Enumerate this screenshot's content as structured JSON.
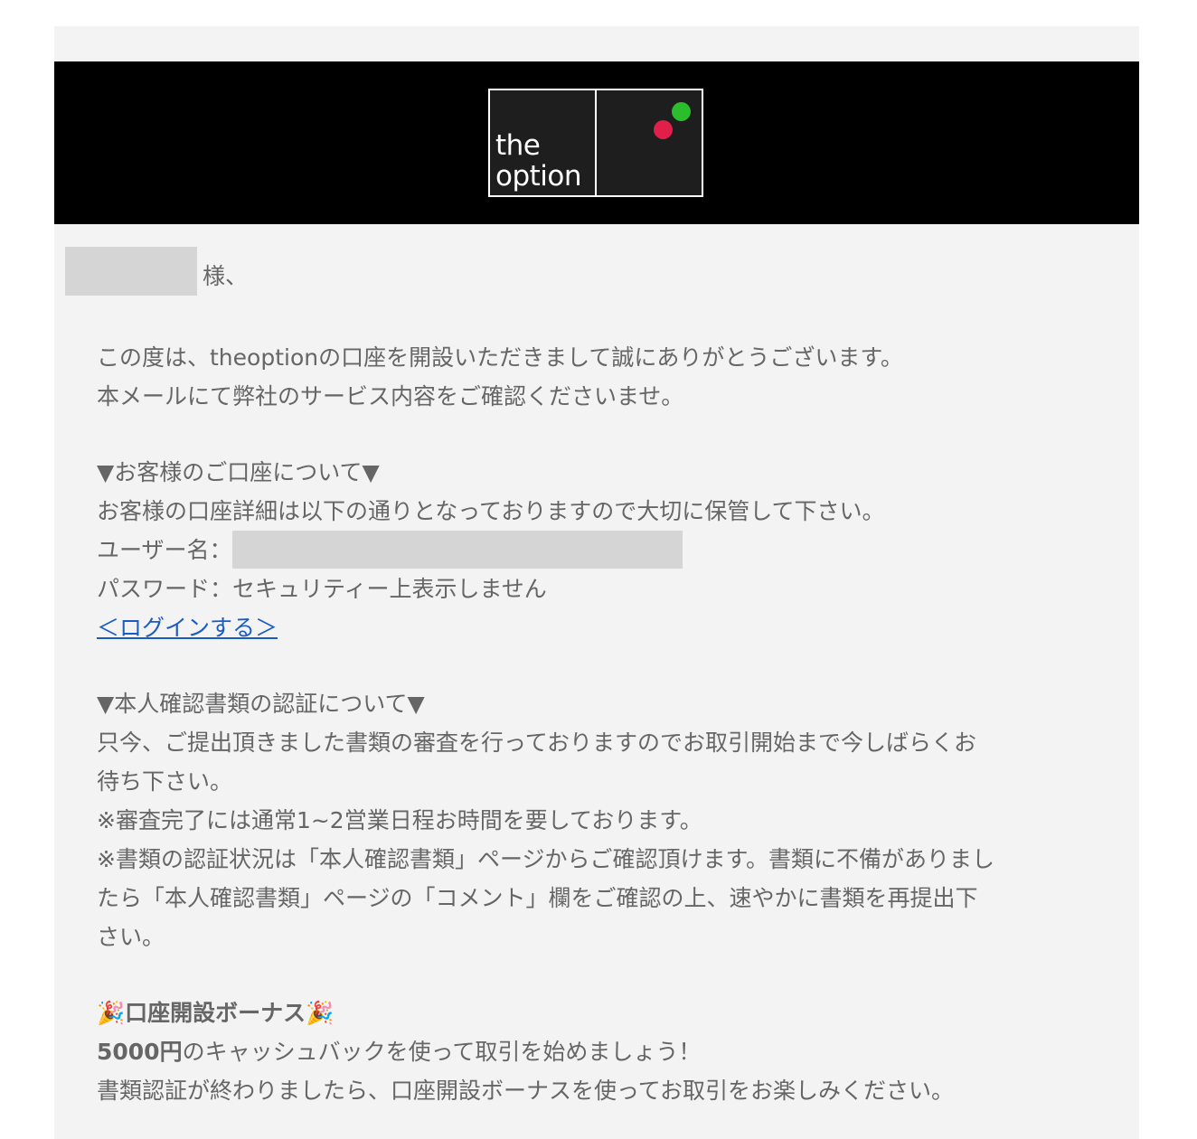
{
  "logo": {
    "line1": "the",
    "line2": "option",
    "dot_green": "#2bbd2b",
    "dot_red": "#e0204a"
  },
  "greeting": {
    "suffix": "様、"
  },
  "intro": {
    "line1": "この度は、theoptionの口座を開設いただきまして誠にありがとうございます。",
    "line2": "本メールにて弊社のサービス内容をご確認くださいませ。"
  },
  "account": {
    "heading": "▼お客様のご口座について▼",
    "desc": "お客様の口座詳細は以下の通りとなっておりますので大切に保管して下さい。",
    "username_label": "ユーザー名：",
    "password_line": "パスワード：セキュリティー上表示しません",
    "login_link": "＜ログインする＞"
  },
  "verification": {
    "heading": "▼本人確認書類の認証について▼",
    "line1": "只今、ご提出頂きました書類の審査を行っておりますのでお取引開始まで今しばらくお",
    "line2": "待ち下さい。",
    "note1": "※審査完了には通常1~2営業日程お時間を要しております。",
    "note2_line1": "※書類の認証状況は「本人確認書類」ページからご確認頂けます。書類に不備がありまし",
    "note2_line2": "たら「本人確認書類」ページの「コメント」欄をご確認の上、速やかに書類を再提出下",
    "note2_line3": "さい。"
  },
  "bonus": {
    "heading": "🎉口座開設ボーナス🎉",
    "amount": "5000円",
    "line1_rest": "のキャッシュバックを使って取引を始めましょう！",
    "line2": "書類認証が終わりましたら、口座開設ボーナスを使ってお取引をお楽しみください。"
  },
  "colors": {
    "text": "#666666",
    "link": "#1a5bc4",
    "background": "#f3f3f3",
    "header": "#000000"
  }
}
